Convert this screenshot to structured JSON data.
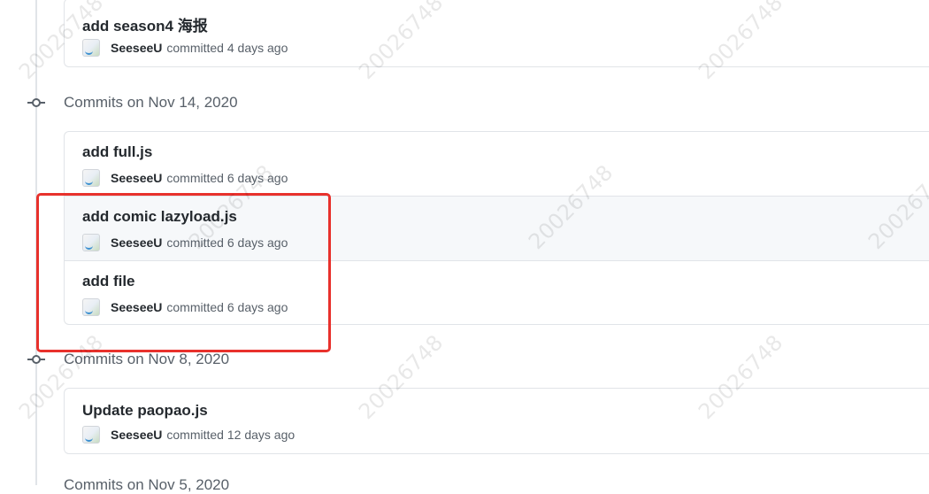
{
  "watermark": "20026748",
  "groups": [
    {
      "header": "",
      "commits": [
        {
          "title": "add season4 海报",
          "author": "SeeseeU",
          "meta": "committed 4 days ago"
        }
      ]
    },
    {
      "header": "Commits on Nov 14, 2020",
      "commits": [
        {
          "title": "add full.js",
          "author": "SeeseeU",
          "meta": "committed 6 days ago"
        },
        {
          "title": "add comic lazyload.js",
          "author": "SeeseeU",
          "meta": "committed 6 days ago"
        },
        {
          "title": "add file",
          "author": "SeeseeU",
          "meta": "committed 6 days ago"
        }
      ]
    },
    {
      "header": "Commits on Nov 8, 2020",
      "commits": [
        {
          "title": "Update paopao.js",
          "author": "SeeseeU",
          "meta": "committed 12 days ago"
        }
      ]
    },
    {
      "header": "Commits on Nov 5, 2020",
      "commits": []
    }
  ],
  "colors": {
    "highlight_border": "#e8312c",
    "border": "#e1e4e8",
    "muted_text": "#586069"
  }
}
